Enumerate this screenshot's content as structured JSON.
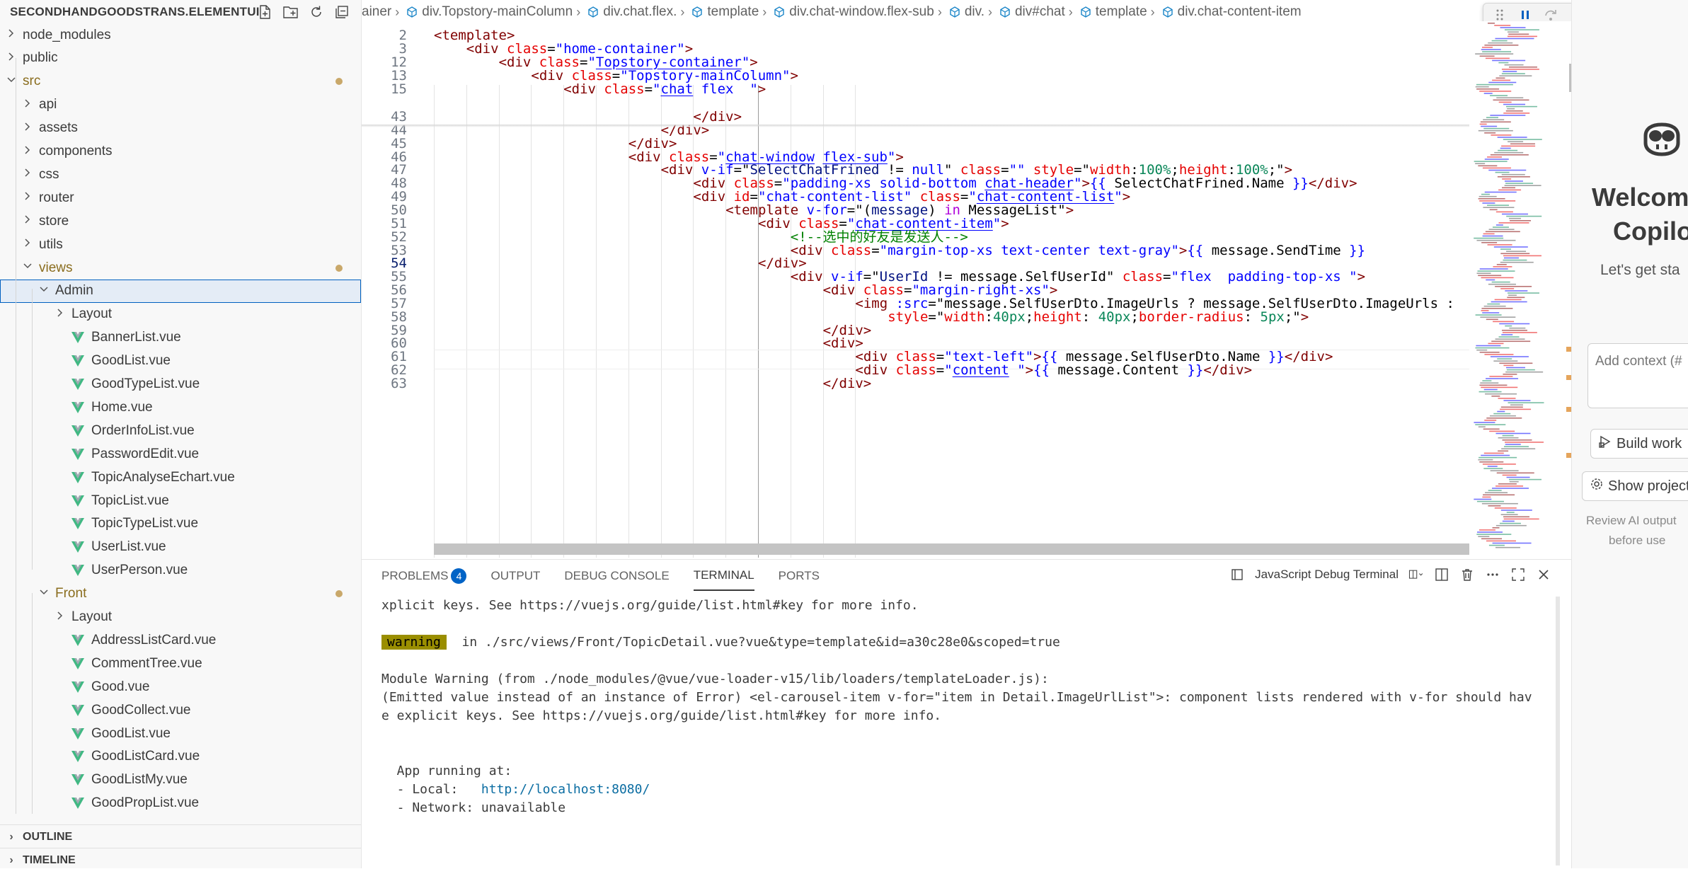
{
  "explorer": {
    "project_title": "SECONDHANDGOODSTRANS.ELEMENTUI",
    "actions": [
      "new-file-icon",
      "new-folder-icon",
      "refresh-icon",
      "collapse-all-icon"
    ],
    "tree": [
      {
        "label": "node_modules",
        "kind": "folder",
        "state": "collapsed"
      },
      {
        "label": "public",
        "kind": "folder",
        "state": "collapsed"
      },
      {
        "label": "src",
        "kind": "folder",
        "state": "expanded",
        "modified": true
      },
      {
        "label": "api",
        "kind": "folder",
        "state": "collapsed"
      },
      {
        "label": "assets",
        "kind": "folder",
        "state": "collapsed"
      },
      {
        "label": "components",
        "kind": "folder",
        "state": "collapsed"
      },
      {
        "label": "css",
        "kind": "folder",
        "state": "collapsed"
      },
      {
        "label": "router",
        "kind": "folder",
        "state": "collapsed"
      },
      {
        "label": "store",
        "kind": "folder",
        "state": "collapsed"
      },
      {
        "label": "utils",
        "kind": "folder",
        "state": "collapsed"
      },
      {
        "label": "views",
        "kind": "folder",
        "state": "expanded",
        "modified": true
      },
      {
        "label": "Admin",
        "kind": "folder",
        "state": "expanded",
        "selected": true
      },
      {
        "label": "Layout",
        "kind": "folder",
        "state": "collapsed"
      },
      {
        "label": "BannerList.vue",
        "kind": "vue"
      },
      {
        "label": "GoodList.vue",
        "kind": "vue"
      },
      {
        "label": "GoodTypeList.vue",
        "kind": "vue"
      },
      {
        "label": "Home.vue",
        "kind": "vue"
      },
      {
        "label": "OrderInfoList.vue",
        "kind": "vue"
      },
      {
        "label": "PasswordEdit.vue",
        "kind": "vue"
      },
      {
        "label": "TopicAnalyseEchart.vue",
        "kind": "vue"
      },
      {
        "label": "TopicList.vue",
        "kind": "vue"
      },
      {
        "label": "TopicTypeList.vue",
        "kind": "vue"
      },
      {
        "label": "UserList.vue",
        "kind": "vue"
      },
      {
        "label": "UserPerson.vue",
        "kind": "vue"
      },
      {
        "label": "Front",
        "kind": "folder",
        "state": "expanded",
        "modified": true
      },
      {
        "label": "Layout",
        "kind": "folder",
        "state": "collapsed"
      },
      {
        "label": "AddressListCard.vue",
        "kind": "vue"
      },
      {
        "label": "CommentTree.vue",
        "kind": "vue"
      },
      {
        "label": "Good.vue",
        "kind": "vue"
      },
      {
        "label": "GoodCollect.vue",
        "kind": "vue"
      },
      {
        "label": "GoodList.vue",
        "kind": "vue"
      },
      {
        "label": "GoodListCard.vue",
        "kind": "vue"
      },
      {
        "label": "GoodListMy.vue",
        "kind": "vue"
      },
      {
        "label": "GoodPropList.vue",
        "kind": "vue"
      }
    ],
    "outline_label": "OUTLINE",
    "timeline_label": "TIMELINE"
  },
  "breadcrumb": [
    "ainer",
    "div.Topstory-mainColumn",
    "div.chat.flex.",
    "template",
    "div.chat-window.flex-sub",
    "div.",
    "div#chat",
    "template",
    "div.chat-content-item"
  ],
  "debug_toolbar": [
    "drag-handle-icon",
    "pause-icon",
    "step-over-icon",
    "step-into-icon",
    "step-out-icon",
    "restart-icon",
    "stop-icon",
    "chevron-down-icon"
  ],
  "editor": {
    "current_line": "54",
    "lines": [
      {
        "n": "2",
        "sticky": true,
        "indent": 0,
        "toks": [
          [
            "tag",
            "<template>"
          ]
        ]
      },
      {
        "n": "3",
        "sticky": true,
        "indent": 4,
        "toks": [
          [
            "tag",
            "<div "
          ],
          [
            "attr",
            "class"
          ],
          [
            "plain",
            "="
          ],
          [
            "str",
            "\"home-container\""
          ],
          [
            "tag",
            ">"
          ]
        ]
      },
      {
        "n": "12",
        "sticky": true,
        "indent": 8,
        "toks": [
          [
            "tag",
            "<div "
          ],
          [
            "attr",
            "class"
          ],
          [
            "plain",
            "="
          ],
          [
            "str",
            "\""
          ],
          [
            "strl",
            "Topstory-container"
          ],
          [
            "str",
            "\""
          ],
          [
            "tag",
            ">"
          ]
        ]
      },
      {
        "n": "13",
        "sticky": true,
        "indent": 12,
        "toks": [
          [
            "tag",
            "<div "
          ],
          [
            "attr",
            "class"
          ],
          [
            "plain",
            "="
          ],
          [
            "str",
            "\"Topstory-mainColumn\""
          ],
          [
            "tag",
            ">"
          ]
        ]
      },
      {
        "n": "15",
        "sticky": true,
        "indent": 16,
        "toks": [
          [
            "tag",
            "<div "
          ],
          [
            "attr",
            "class"
          ],
          [
            "plain",
            "="
          ],
          [
            "str",
            "\""
          ],
          [
            "strl",
            "chat"
          ],
          [
            "str",
            " flex  \""
          ],
          [
            "tag",
            ">"
          ]
        ]
      },
      {
        "n": "43",
        "indent": 32,
        "toks": [
          [
            "tag",
            "</div>"
          ]
        ]
      },
      {
        "n": "44",
        "indent": 28,
        "toks": [
          [
            "tag",
            "</div>"
          ]
        ]
      },
      {
        "n": "45",
        "indent": 24,
        "toks": [
          [
            "tag",
            "</div>"
          ]
        ]
      },
      {
        "n": "46",
        "indent": 24,
        "toks": [
          [
            "tag",
            "<div "
          ],
          [
            "attr",
            "class"
          ],
          [
            "plain",
            "="
          ],
          [
            "str",
            "\""
          ],
          [
            "strl",
            "chat-window"
          ],
          [
            "str",
            " "
          ],
          [
            "strl",
            "flex-sub"
          ],
          [
            "str",
            "\""
          ],
          [
            "tag",
            ">"
          ]
        ]
      },
      {
        "n": "47",
        "indent": 28,
        "toks": [
          [
            "tag",
            "<div "
          ],
          [
            "dir",
            "v-if"
          ],
          [
            "plain",
            "=\""
          ],
          [
            "ident",
            "SelectChatFrined"
          ],
          [
            "plain",
            " != "
          ],
          [
            "dir",
            "null"
          ],
          [
            "plain",
            "\" "
          ],
          [
            "attr",
            "class"
          ],
          [
            "plain",
            "="
          ],
          [
            "str",
            "\"\" "
          ],
          [
            "attr",
            "style"
          ],
          [
            "plain",
            "=\""
          ],
          [
            "attr",
            "width"
          ],
          [
            "plain",
            ":"
          ],
          [
            "vf",
            "100%"
          ],
          [
            "plain",
            ";"
          ],
          [
            "attr",
            "height"
          ],
          [
            "plain",
            ":"
          ],
          [
            "vf",
            "100%"
          ],
          [
            "plain",
            ";\""
          ],
          [
            "tag",
            ">"
          ]
        ]
      },
      {
        "n": "48",
        "indent": 32,
        "toks": [
          [
            "tag",
            "<div "
          ],
          [
            "attr",
            "class"
          ],
          [
            "plain",
            "="
          ],
          [
            "str",
            "\"padding-xs solid-bottom "
          ],
          [
            "strl",
            "chat-header"
          ],
          [
            "str",
            "\""
          ],
          [
            "tag",
            ">"
          ],
          [
            "dir",
            "{{"
          ],
          [
            "plain",
            " SelectChatFrined.Name "
          ],
          [
            "dir",
            "}}"
          ],
          [
            "tag",
            "</div>"
          ]
        ]
      },
      {
        "n": "49",
        "indent": 32,
        "toks": [
          [
            "tag",
            "<div "
          ],
          [
            "attr",
            "id"
          ],
          [
            "plain",
            "="
          ],
          [
            "str",
            "\"chat-content-list\" "
          ],
          [
            "attr",
            "class"
          ],
          [
            "plain",
            "="
          ],
          [
            "str",
            "\""
          ],
          [
            "strl",
            "chat-content-list"
          ],
          [
            "str",
            "\""
          ],
          [
            "tag",
            ">"
          ]
        ]
      },
      {
        "n": "50",
        "indent": 36,
        "toks": [
          [
            "tag",
            "<template "
          ],
          [
            "dir",
            "v-for"
          ],
          [
            "plain",
            "=\"("
          ],
          [
            "ident",
            "message"
          ],
          [
            "plain",
            ") "
          ],
          [
            "kw",
            "in"
          ],
          [
            "plain",
            " MessageList\""
          ],
          [
            "tag",
            ">"
          ]
        ]
      },
      {
        "n": "51",
        "indent": 40,
        "toks": [
          [
            "tag",
            "<div "
          ],
          [
            "attr",
            "class"
          ],
          [
            "plain",
            "="
          ],
          [
            "str",
            "\""
          ],
          [
            "strl",
            "chat-content-item"
          ],
          [
            "str",
            "\""
          ],
          [
            "tag",
            ">"
          ]
        ]
      },
      {
        "n": "52",
        "indent": 44,
        "toks": [
          [
            "cmt",
            "<!--选中的好友是发送人-->"
          ]
        ]
      },
      {
        "n": "53",
        "indent": 44,
        "toks": [
          [
            "tag",
            "<div "
          ],
          [
            "attr",
            "class"
          ],
          [
            "plain",
            "="
          ],
          [
            "str",
            "\"margin-top-xs text-center text-gray\""
          ],
          [
            "tag",
            ">"
          ],
          [
            "dir",
            "{{"
          ],
          [
            "plain",
            " message.SendTime "
          ],
          [
            "dir",
            "}}"
          ]
        ]
      },
      {
        "n": "54",
        "indent": 40,
        "toks": [
          [
            "tag",
            "</div>"
          ]
        ]
      },
      {
        "n": "55",
        "indent": 44,
        "toks": [
          [
            "tag",
            "<div "
          ],
          [
            "dir",
            "v-if"
          ],
          [
            "plain",
            "=\""
          ],
          [
            "ident",
            "UserId"
          ],
          [
            "plain",
            " != message.SelfUserId\" "
          ],
          [
            "attr",
            "class"
          ],
          [
            "plain",
            "="
          ],
          [
            "str",
            "\"flex  padding-top-xs \""
          ],
          [
            "tag",
            ">"
          ]
        ]
      },
      {
        "n": "56",
        "indent": 48,
        "toks": [
          [
            "tag",
            "<div "
          ],
          [
            "attr",
            "class"
          ],
          [
            "plain",
            "="
          ],
          [
            "str",
            "\"margin-right-xs\""
          ],
          [
            "tag",
            ">"
          ]
        ]
      },
      {
        "n": "57",
        "indent": 52,
        "toks": [
          [
            "tag",
            "<img "
          ],
          [
            "dir",
            ":src"
          ],
          [
            "plain",
            "=\"message.SelfUserDto.ImageUrls ? message.SelfUserDto.ImageUrls :"
          ]
        ]
      },
      {
        "n": "58",
        "indent": 56,
        "toks": [
          [
            "attr",
            "style"
          ],
          [
            "plain",
            "=\""
          ],
          [
            "attr",
            "width"
          ],
          [
            "plain",
            ":"
          ],
          [
            "vf",
            "40px"
          ],
          [
            "plain",
            ";"
          ],
          [
            "attr",
            "height"
          ],
          [
            "plain",
            ": "
          ],
          [
            "vf",
            "40px"
          ],
          [
            "plain",
            ";"
          ],
          [
            "attr",
            "border-radius"
          ],
          [
            "plain",
            ": "
          ],
          [
            "vf",
            "5px"
          ],
          [
            "plain",
            ";\""
          ],
          [
            "tag",
            ">"
          ]
        ]
      },
      {
        "n": "59",
        "indent": 48,
        "toks": [
          [
            "tag",
            "</div>"
          ]
        ]
      },
      {
        "n": "60",
        "indent": 48,
        "toks": [
          [
            "tag",
            "<div>"
          ]
        ]
      },
      {
        "n": "61",
        "indent": 52,
        "toks": [
          [
            "tag",
            "<div "
          ],
          [
            "attr",
            "class"
          ],
          [
            "plain",
            "="
          ],
          [
            "str",
            "\"text-left\""
          ],
          [
            "tag",
            ">"
          ],
          [
            "dir",
            "{{"
          ],
          [
            "plain",
            " message.SelfUserDto.Name "
          ],
          [
            "dir",
            "}}"
          ],
          [
            "tag",
            "</div>"
          ]
        ]
      },
      {
        "n": "62",
        "indent": 52,
        "toks": [
          [
            "tag",
            "<div "
          ],
          [
            "attr",
            "class"
          ],
          [
            "plain",
            "="
          ],
          [
            "str",
            "\""
          ],
          [
            "strl",
            "content"
          ],
          [
            "str",
            " \""
          ],
          [
            "tag",
            ">"
          ],
          [
            "dir",
            "{{"
          ],
          [
            "plain",
            " message.Content "
          ],
          [
            "dir",
            "}}"
          ],
          [
            "tag",
            "</div>"
          ]
        ]
      },
      {
        "n": "63",
        "indent": 48,
        "toks": [
          [
            "tag",
            "</div>"
          ]
        ]
      }
    ]
  },
  "panel": {
    "tabs": [
      {
        "label": "PROBLEMS",
        "badge": "4"
      },
      {
        "label": "OUTPUT"
      },
      {
        "label": "DEBUG CONSOLE"
      },
      {
        "label": "TERMINAL",
        "active": true
      },
      {
        "label": "PORTS"
      }
    ],
    "terminal_name": "JavaScript Debug Terminal",
    "terminal_lines": [
      {
        "text": "xplicit keys. See https://vuejs.org/guide/list.html#key for more info."
      },
      {
        "text": ""
      },
      {
        "badge": "warning",
        "text": "  in ./src/views/Front/TopicDetail.vue?vue&type=template&id=a30c28e0&scoped=true"
      },
      {
        "text": ""
      },
      {
        "text": "Module Warning (from ./node_modules/@vue/vue-loader-v15/lib/loaders/templateLoader.js):"
      },
      {
        "text": "(Emitted value instead of an instance of Error) <el-carousel-item v-for=\"item in Detail.ImageUrlList\">: component lists rendered with v-for should hav"
      },
      {
        "text": "e explicit keys. See https://vuejs.org/guide/list.html#key for more info."
      },
      {
        "text": ""
      },
      {
        "text": ""
      },
      {
        "text": "  App running at:"
      },
      {
        "text": "  - Local:   ",
        "link": "http://localhost:8080/"
      },
      {
        "text": "  - Network: unavailable"
      }
    ]
  },
  "copilot": {
    "title_line1": "Welcome",
    "title_line2": "Copilo",
    "subtitle": "Let's get sta",
    "context_placeholder": "Add context (#",
    "build_label": "Build work",
    "show_label": "Show project",
    "note_line1": "Review AI output",
    "note_line2": "before use"
  }
}
